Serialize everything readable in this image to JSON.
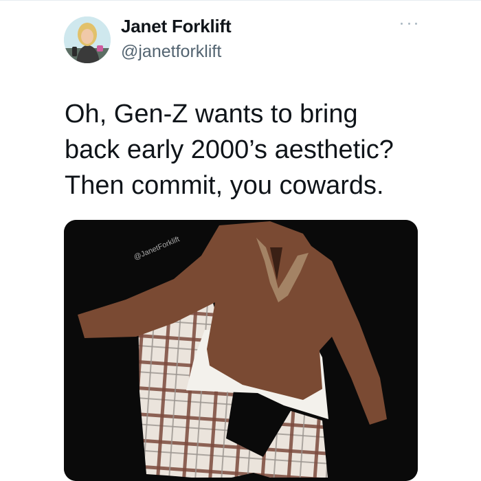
{
  "tweet": {
    "author": {
      "display_name": "Janet Forklift",
      "handle": "@janetforklift",
      "avatar_icon": "profile-photo"
    },
    "more_icon": "ellipsis-icon",
    "text_lines": [
      "Oh, Gen-Z wants to bring",
      "back early 2000’s aesthetic?",
      "Then commit, you cowards."
    ],
    "media": {
      "watermark": "@JanetForklift",
      "colors": {
        "background": "#0a0a0a",
        "shirt": "#7a4a33",
        "undershirt": "#f3f1ec",
        "shorts_base": "#ebe4dc",
        "plaid_brown": "#7b4a3c",
        "plaid_gray": "#9a948e"
      }
    }
  }
}
